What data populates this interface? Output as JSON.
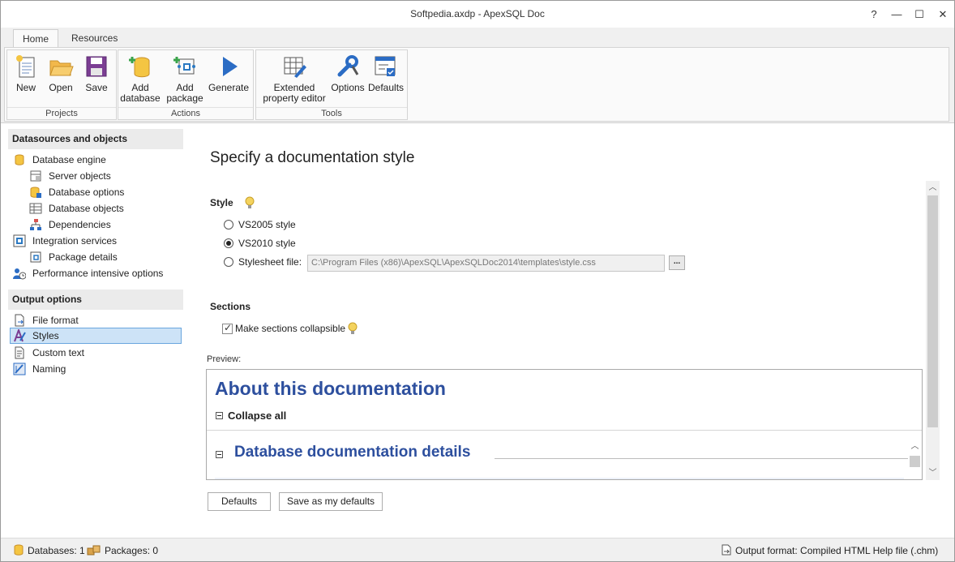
{
  "window": {
    "title": "Softpedia.axdp - ApexSQL Doc",
    "help": "?",
    "minimize": "—",
    "maximize": "☐",
    "close": "✕"
  },
  "tabs": [
    {
      "label": "Home",
      "active": true
    },
    {
      "label": "Resources",
      "active": false
    }
  ],
  "ribbon": {
    "groups": [
      {
        "label": "Projects",
        "buttons": [
          {
            "label": "New",
            "icon": "new-document-icon"
          },
          {
            "label": "Open",
            "icon": "folder-open-icon"
          },
          {
            "label": "Save",
            "icon": "floppy-save-icon"
          }
        ]
      },
      {
        "label": "Actions",
        "buttons": [
          {
            "label": "Add database",
            "line1": "Add",
            "line2": "database",
            "icon": "add-database-icon"
          },
          {
            "label": "Add package",
            "line1": "Add",
            "line2": "package",
            "icon": "add-package-icon"
          },
          {
            "label": "Generate",
            "icon": "play-arrow-icon"
          }
        ]
      },
      {
        "label": "Tools",
        "buttons": [
          {
            "label": "Extended property editor",
            "line1": "Extended",
            "line2": "property editor",
            "icon": "grid-edit-icon"
          },
          {
            "label": "Options",
            "icon": "wrench-icon"
          },
          {
            "label": "Defaults",
            "icon": "defaults-icon"
          }
        ]
      }
    ]
  },
  "sidebar": {
    "datasources_header": "Datasources and objects",
    "datasources": [
      {
        "label": "Database engine",
        "icon": "database-icon",
        "level": 0
      },
      {
        "label": "Server objects",
        "icon": "server-objects-icon",
        "level": 1
      },
      {
        "label": "Database options",
        "icon": "database-options-icon",
        "level": 1
      },
      {
        "label": "Database objects",
        "icon": "table-grid-icon",
        "level": 1
      },
      {
        "label": "Dependencies",
        "icon": "dependencies-icon",
        "level": 1
      },
      {
        "label": "Integration services",
        "icon": "integration-services-icon",
        "level": 0
      },
      {
        "label": "Package details",
        "icon": "package-details-icon",
        "level": 1
      },
      {
        "label": "Performance intensive options",
        "icon": "performance-users-icon",
        "level": 0
      }
    ],
    "output_header": "Output options",
    "output": [
      {
        "label": "File format",
        "icon": "file-format-icon",
        "selected": false
      },
      {
        "label": "Styles",
        "icon": "styles-icon",
        "selected": true
      },
      {
        "label": "Custom text",
        "icon": "custom-text-icon",
        "selected": false
      },
      {
        "label": "Naming",
        "icon": "naming-icon",
        "selected": false
      }
    ]
  },
  "main": {
    "heading": "Specify a documentation style",
    "style_label": "Style",
    "radios": [
      {
        "label": "VS2005 style",
        "checked": false
      },
      {
        "label": "VS2010 style",
        "checked": true
      },
      {
        "label": "Stylesheet file:",
        "checked": false
      }
    ],
    "stylesheet_path": "C:\\Program Files (x86)\\ApexSQL\\ApexSQLDoc2014\\templates\\style.css",
    "browse_label": "...",
    "sections_label": "Sections",
    "collapsible_label": "Make sections collapsible",
    "collapsible_checked": true,
    "preview_label": "Preview:",
    "preview": {
      "title": "About this documentation",
      "collapse_all": "Collapse all",
      "section_title": "Database documentation details"
    },
    "defaults_button": "Defaults",
    "save_defaults_button": "Save as my defaults"
  },
  "statusbar": {
    "databases": "Databases: 1",
    "packages": "Packages: 0",
    "output_format": "Output format: Compiled HTML Help file (.chm)"
  },
  "colors": {
    "accent": "#2d4f9e",
    "selection": "#cde3f7",
    "selection_border": "#6aa6de"
  }
}
